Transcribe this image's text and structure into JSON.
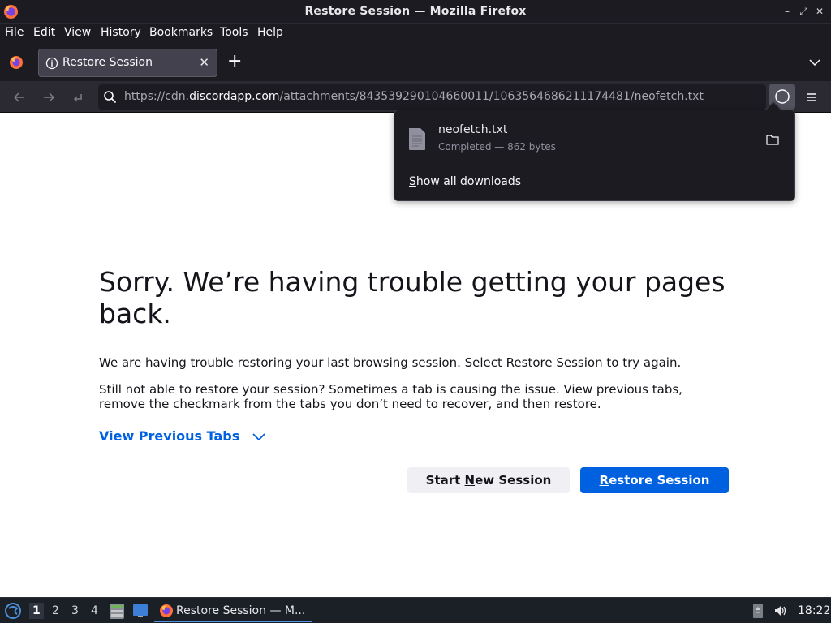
{
  "window": {
    "title": "Restore Session — Mozilla Firefox"
  },
  "menubar": {
    "items": [
      "File",
      "Edit",
      "View",
      "History",
      "Bookmarks",
      "Tools",
      "Help"
    ]
  },
  "tabs": [
    {
      "label": "Restore Session",
      "active": true
    }
  ],
  "urlbar": {
    "scheme": "https://cdn.",
    "host": "discordapp.com",
    "path": "/attachments/843539290104660011/1063564686211174481/neofetch.txt"
  },
  "downloads_panel": {
    "file_name": "neofetch.txt",
    "status": "Completed — 862 bytes",
    "show_all_prefix": "S",
    "show_all_rest": "how all downloads"
  },
  "page": {
    "heading": "Sorry. We’re having trouble getting your pages back.",
    "para1": "We are having trouble restoring your last browsing session. Select Restore Session to try again.",
    "para2": "Still not able to restore your session? Sometimes a tab is causing the issue. View previous tabs, remove the checkmark from the tabs you don’t need to recover, and then restore.",
    "view_previous": "View Previous Tabs",
    "start_btn": {
      "pre": "Start ",
      "key": "N",
      "post": "ew Session"
    },
    "restore_btn": {
      "key": "R",
      "post": "estore Session"
    }
  },
  "taskbar": {
    "workspaces": [
      "1",
      "2",
      "3",
      "4"
    ],
    "active_workspace": "1",
    "task_label": "Restore Session — M...",
    "clock": "18:22"
  },
  "colors": {
    "accent": "#0061e0",
    "chrome_dark": "#1c1b22",
    "navbar": "#2b2a33"
  }
}
